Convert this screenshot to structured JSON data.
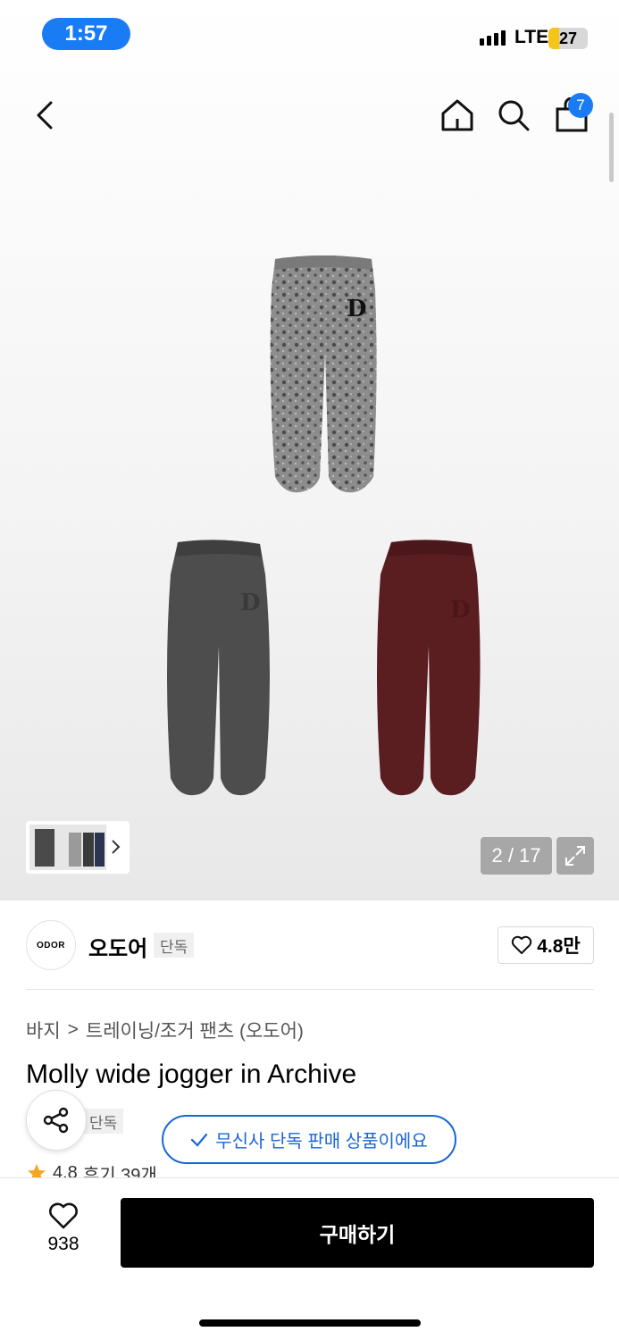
{
  "status_bar": {
    "time": "1:57",
    "network": "LTE",
    "battery": "27",
    "battery_level": 0.27
  },
  "nav": {
    "cart_count": "7"
  },
  "gallery": {
    "counter": "2 / 17"
  },
  "brand": {
    "logo_text": "ODOR",
    "name": "오도어",
    "tag": "단독",
    "likes": "4.8만"
  },
  "breadcrumb": {
    "category": "바지",
    "separator": ">",
    "subcategory": "트레이닝/조거 팬츠 (오도어)"
  },
  "product": {
    "title": "Molly wide jogger in Archive",
    "exclusive_tag": "단독",
    "rating": "4.8",
    "reviews": "후기 39개"
  },
  "exclusive_notice": "무신사 단독 판매 상품이에요",
  "bottom_bar": {
    "wish_count": "938",
    "buy_label": "구매하기"
  },
  "colors": {
    "accent": "#1a7cf5",
    "exclusive": "#1a66d6",
    "star": "#f5a623",
    "buy": "#000000"
  },
  "icons": [
    "back-icon",
    "home-icon",
    "search-icon",
    "cart-icon",
    "expand-icon",
    "chevron-right-icon",
    "heart-icon",
    "share-icon",
    "check-icon",
    "star-icon"
  ]
}
